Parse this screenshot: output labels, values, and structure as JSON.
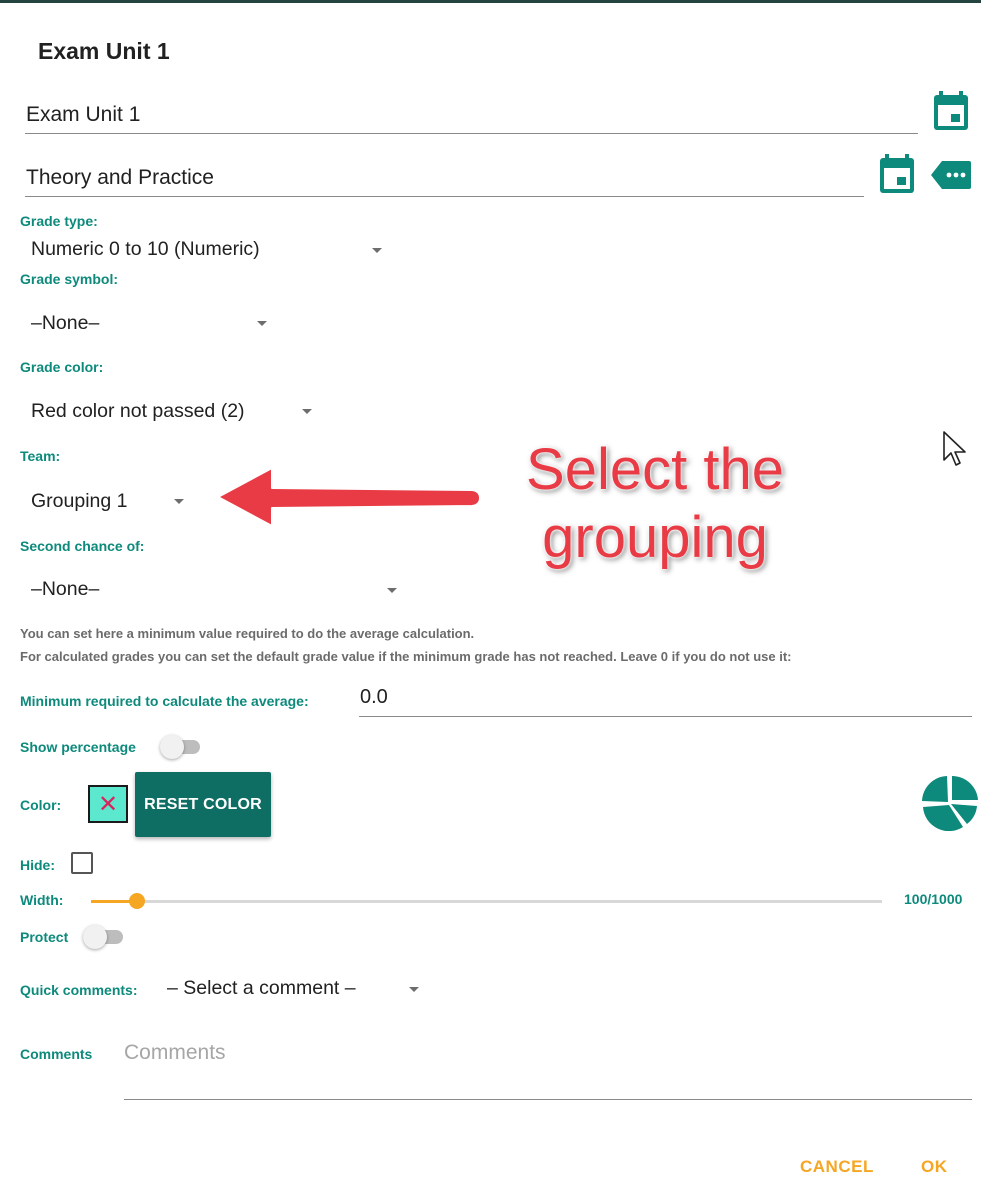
{
  "dialog": {
    "title": "Exam Unit 1"
  },
  "fields": {
    "name_value": "Exam Unit 1",
    "description_value": "Theory and Practice"
  },
  "grade_type": {
    "label": "Grade type:",
    "value": "Numeric 0 to 10  (Numeric)"
  },
  "grade_symbol": {
    "label": "Grade symbol:",
    "value": "–None–"
  },
  "grade_color": {
    "label": "Grade color:",
    "value": "Red color not passed (2)"
  },
  "team": {
    "label": "Team:",
    "value": "Grouping 1"
  },
  "second_chance": {
    "label": "Second chance of:",
    "value": "–None–"
  },
  "help": {
    "line1": "You can set here a minimum value required to do the average calculation.",
    "line2": "For calculated grades you can set the default grade value if the minimum grade has not reached. Leave 0 if you do not use it:"
  },
  "minimum": {
    "label": "Minimum required to calculate the average:",
    "value": "0.0"
  },
  "show_percentage": {
    "label": "Show percentage",
    "on": false
  },
  "color": {
    "label": "Color:",
    "swatch_mark": "✕",
    "swatch_color": "#5ce8cf",
    "reset_label": "RESET COLOR"
  },
  "hide": {
    "label": "Hide:",
    "checked": false
  },
  "width": {
    "label": "Width:",
    "value": 100,
    "max": 1000,
    "display": "100/1000"
  },
  "protect": {
    "label": "Protect",
    "on": false
  },
  "quick_comments": {
    "label": "Quick comments:",
    "value": "– Select a comment –"
  },
  "comments": {
    "label": "Comments",
    "placeholder": "Comments"
  },
  "footer": {
    "cancel_label": "CANCEL",
    "ok_label": "OK"
  },
  "annotation": {
    "text": "Select the grouping",
    "color": "#e93b45"
  },
  "icons": {
    "date_picker": "calendar-icon",
    "more_options": "label-more-icon",
    "chart": "pie-chart-icon",
    "pointer": "mouse-cursor-icon"
  },
  "colors": {
    "accent": "#0d8a7c",
    "button_bg": "#0f6e63",
    "action": "#f5a623"
  }
}
